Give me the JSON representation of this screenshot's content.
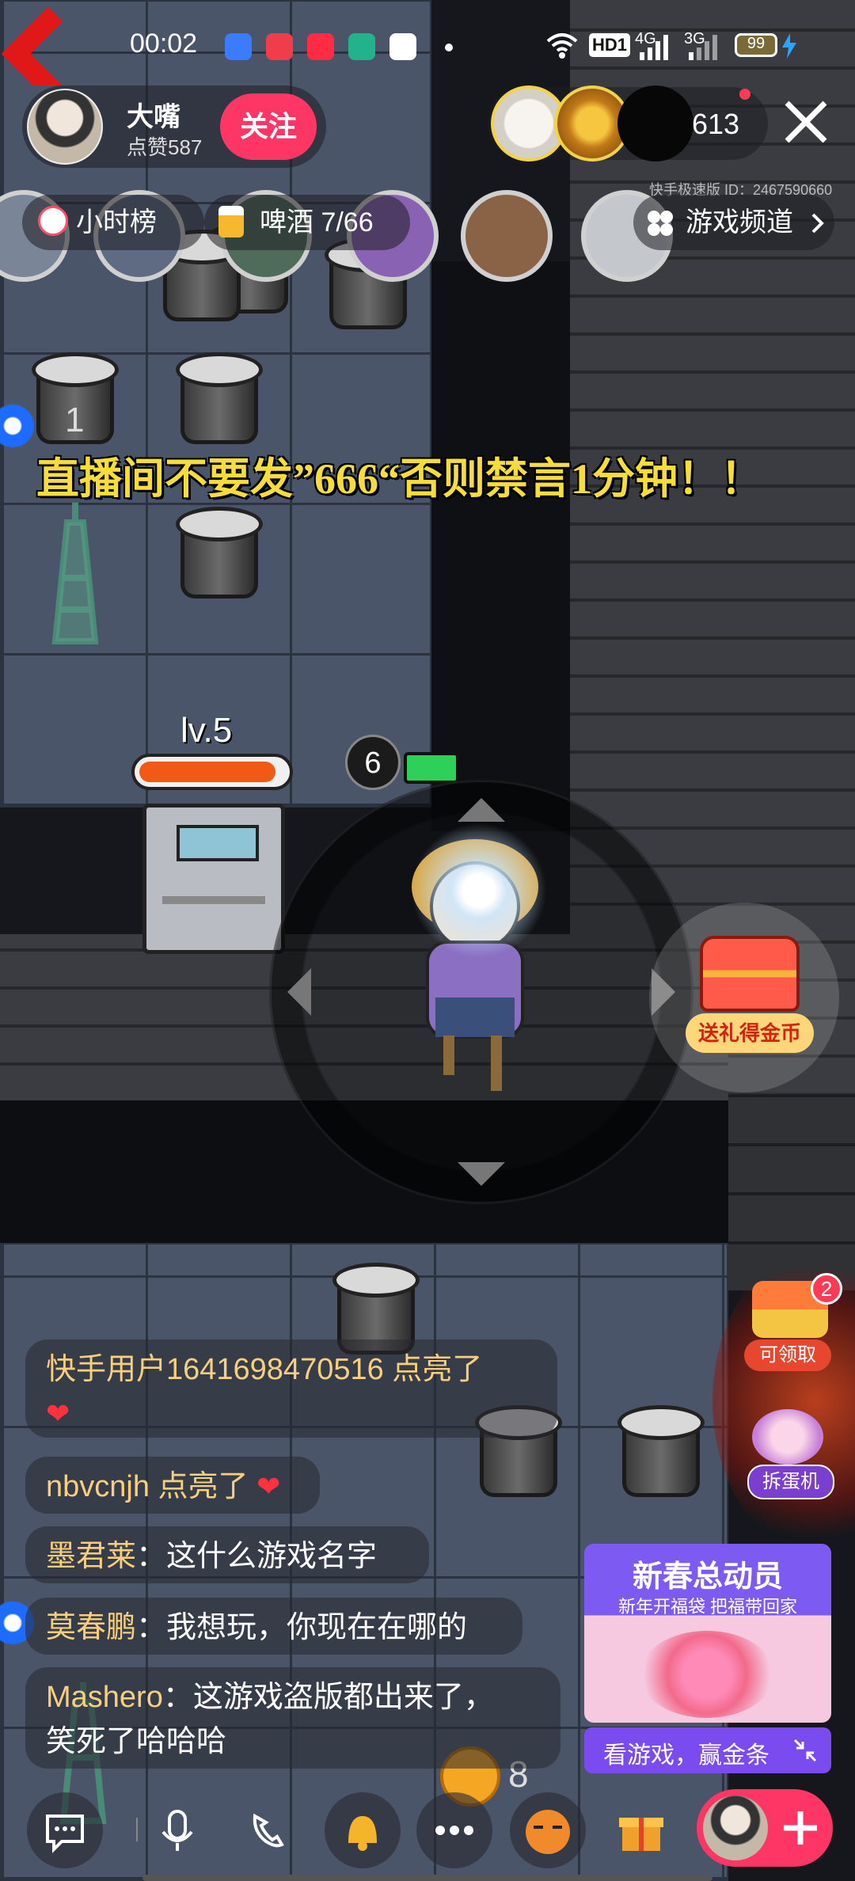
{
  "status_bar": {
    "time": "00:02",
    "network": "HD1",
    "net_4g": "4G",
    "net_3g": "3G",
    "battery": "99"
  },
  "streamer": {
    "name": "大嘴",
    "likes": "点赞587",
    "follow_label": "关注"
  },
  "viewer_count": "613",
  "room_id": "快手极速版 ID：2467590660",
  "tags": {
    "hour_rank": "小时榜",
    "beer": "啤酒 7/66",
    "game_channel": "游戏频道"
  },
  "announcement": "直播间不要发”666“否则禁言1分钟！！",
  "game": {
    "level_label": "lv.5",
    "counter": "6",
    "badge_one": "1",
    "coin_count": "8"
  },
  "gift_box_label": "送礼得金币",
  "side": {
    "claim_badge": "2",
    "claim_label": "可领取",
    "egg_label": "拆蛋机"
  },
  "promo": {
    "title": "新春总动员",
    "subtitle": "新年开福袋 把福带回家",
    "cta": "看游戏，赢金条"
  },
  "comments": [
    {
      "user": "快手用户1641698470516",
      "text": " 点亮了"
    },
    {
      "user": "nbvcnjh",
      "text": " 点亮了"
    },
    {
      "user": "墨君莱",
      "text": "：这什么游戏名字"
    },
    {
      "user": "莫春鹏",
      "text": "：我想玩，你现在在哪的"
    },
    {
      "user": "Mashero",
      "text": "：这游戏盗版都出来了，",
      "text2": "笑死了哈哈哈"
    }
  ],
  "colors": {
    "accent_pink": "#fe3666",
    "username_gold": "#f7cf7f",
    "announcement_yellow": "#f6dd3c",
    "promo_purple": "#7a4cf0"
  }
}
